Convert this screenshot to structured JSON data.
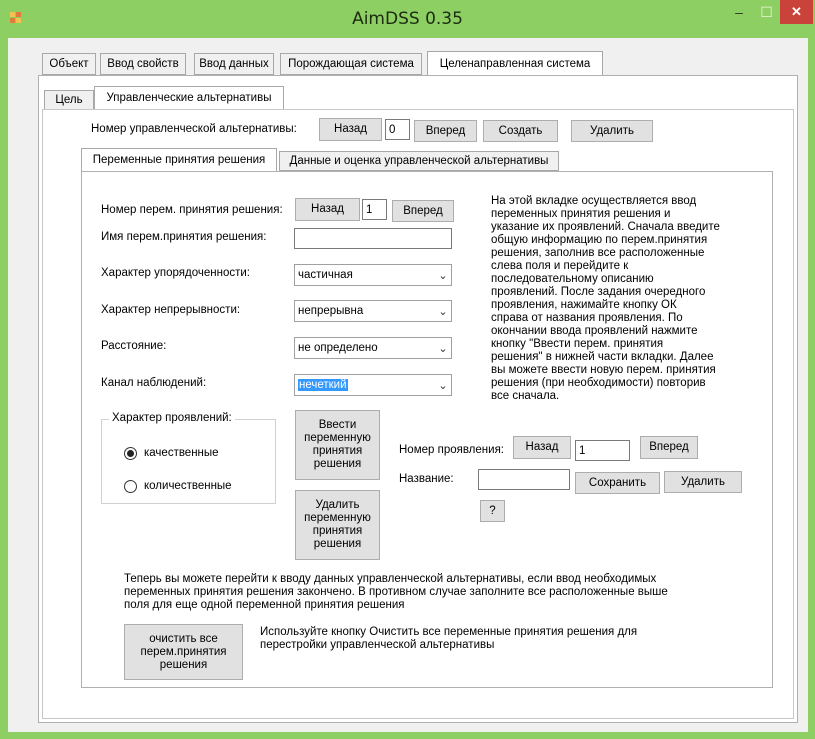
{
  "window": {
    "title": "AimDSS 0.35",
    "min_label": "–",
    "max_label": "☐",
    "close_label": "✕"
  },
  "colors": {
    "titlebar": "#8dcf62",
    "close": "#c9433a",
    "selection": "#3399ff"
  },
  "main_tabs": [
    "Объект",
    "Ввод свойств",
    "Ввод данных",
    "Порождающая система",
    "Целенаправленная система"
  ],
  "sub_tabs": [
    "Цель",
    "Управленческие альтернативы"
  ],
  "alt": {
    "label": "Номер управленческой альтернативы:",
    "back": "Назад",
    "number": "0",
    "forward": "Вперед",
    "create": "Создать",
    "delete": "Удалить"
  },
  "inner_tabs": [
    "Переменные принятия решения",
    "Данные и оценка управленческой альтернативы"
  ],
  "var": {
    "number_label": "Номер перем. принятия решения:",
    "back": "Назад",
    "number": "1",
    "forward": "Вперед",
    "name_label": "Имя перем.принятия решения:",
    "name_value": "",
    "order_label": "Характер упорядоченности:",
    "order_value": "частичная",
    "cont_label": "Характер непрерывности:",
    "cont_value": "непрерывна",
    "dist_label": "Расстояние:",
    "dist_value": "не определено",
    "channel_label": "Канал наблюдений:",
    "channel_value": "нечеткий"
  },
  "manifest_group": {
    "title": "Характер проявлений:",
    "opt1": "качественные",
    "opt2": "количественные",
    "selected": "качественные"
  },
  "buttons": {
    "enter_var": [
      "Ввести",
      "переменную",
      "принятия",
      "решения"
    ],
    "delete_var": [
      "Удалить",
      "переменную",
      "принятия",
      "решения"
    ],
    "clear_all": [
      "очистить все",
      "перем.принятия",
      "решения"
    ]
  },
  "help_text": [
    "На этой вкладке осуществляется ввод",
    "переменных принятия решения и",
    "указание их проявлений. Сначала введите",
    "общую информацию по перем.принятия",
    "решения, заполнив все расположенные",
    "слева поля и перейдите к",
    "последовательному описанию",
    "проявлений. После задания очередного",
    "проявления, нажимайте кнопку ОК",
    "справа от названия проявления. По",
    "окончании ввода проявлений нажмите",
    "кнопку \"Ввести перем. принятия",
    "решения\" в нижней части вкладки. Далее",
    "вы можете ввести новую перем. принятия",
    "решения (при необходимости) повторив",
    "все сначала."
  ],
  "manifest": {
    "number_label": "Номер проявления:",
    "back": "Назад",
    "number": "1",
    "forward": "Вперед",
    "name_label": "Название:",
    "name_value": "",
    "save": "Сохранить",
    "delete": "Удалить",
    "help": "?"
  },
  "bottom_text": [
    "Теперь вы можете перейти к вводу данных управленческой альтернативы, если  ввод необходимых",
    "переменных принятия решения закончено. В противном случае заполните все расположенные выше",
    "поля для еще одной переменной принятия решения"
  ],
  "clear_text": [
    "Используйте кнопку Очистить все переменные принятия решения для",
    "перестройки управленческой альтернативы"
  ]
}
